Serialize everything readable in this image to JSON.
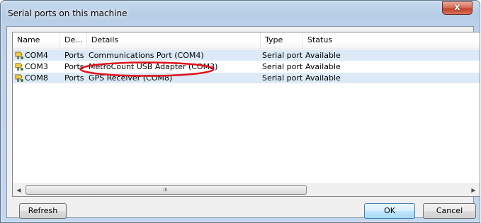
{
  "window": {
    "title": "Serial ports on this machine",
    "close_glyph": "x"
  },
  "list": {
    "columns": [
      "Name",
      "De...",
      "Details",
      "Type",
      "Status"
    ],
    "rows": [
      {
        "name": "COM4",
        "device": "Ports",
        "details": "Communications Port (COM4)",
        "type": "Serial port",
        "status": "Available"
      },
      {
        "name": "COM3",
        "device": "Ports",
        "details": "MetroCount USB Adapter (COM3)",
        "type": "Serial port",
        "status": "Available"
      },
      {
        "name": "COM8",
        "device": "Ports",
        "details": "GPS Receiver (COM8)",
        "type": "Serial port",
        "status": "Available"
      }
    ],
    "row_icon": "serial-port-icon"
  },
  "scrollbar": {
    "left_arrow": "◀",
    "right_arrow": "▶",
    "grip": "III"
  },
  "buttons": {
    "refresh": "Refresh",
    "ok": "OK",
    "cancel": "Cancel"
  },
  "annotation": {
    "color": "#e0101a"
  }
}
